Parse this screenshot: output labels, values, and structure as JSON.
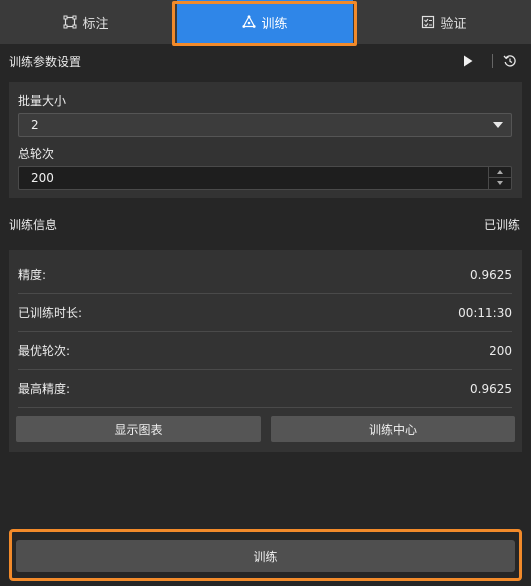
{
  "tabs": [
    {
      "label": "标注",
      "icon": "annotate-icon",
      "active": false
    },
    {
      "label": "训练",
      "icon": "train-icon",
      "active": true
    },
    {
      "label": "验证",
      "icon": "validate-icon",
      "active": false
    }
  ],
  "params": {
    "title": "训练参数设置",
    "batch_size_label": "批量大小",
    "batch_size_value": "2",
    "epochs_label": "总轮次",
    "epochs_value": "200"
  },
  "info": {
    "title": "训练信息",
    "status": "已训练",
    "rows": [
      {
        "key": "精度:",
        "value": "0.9625"
      },
      {
        "key": "已训练时长:",
        "value": "00:11:30"
      },
      {
        "key": "最优轮次:",
        "value": "200"
      },
      {
        "key": "最高精度:",
        "value": "0.9625"
      }
    ],
    "show_chart_label": "显示图表",
    "train_center_label": "训练中心"
  },
  "train_button_label": "训练",
  "colors": {
    "accent": "#2f86e8",
    "highlight": "#f28a2a",
    "background": "#262626"
  }
}
